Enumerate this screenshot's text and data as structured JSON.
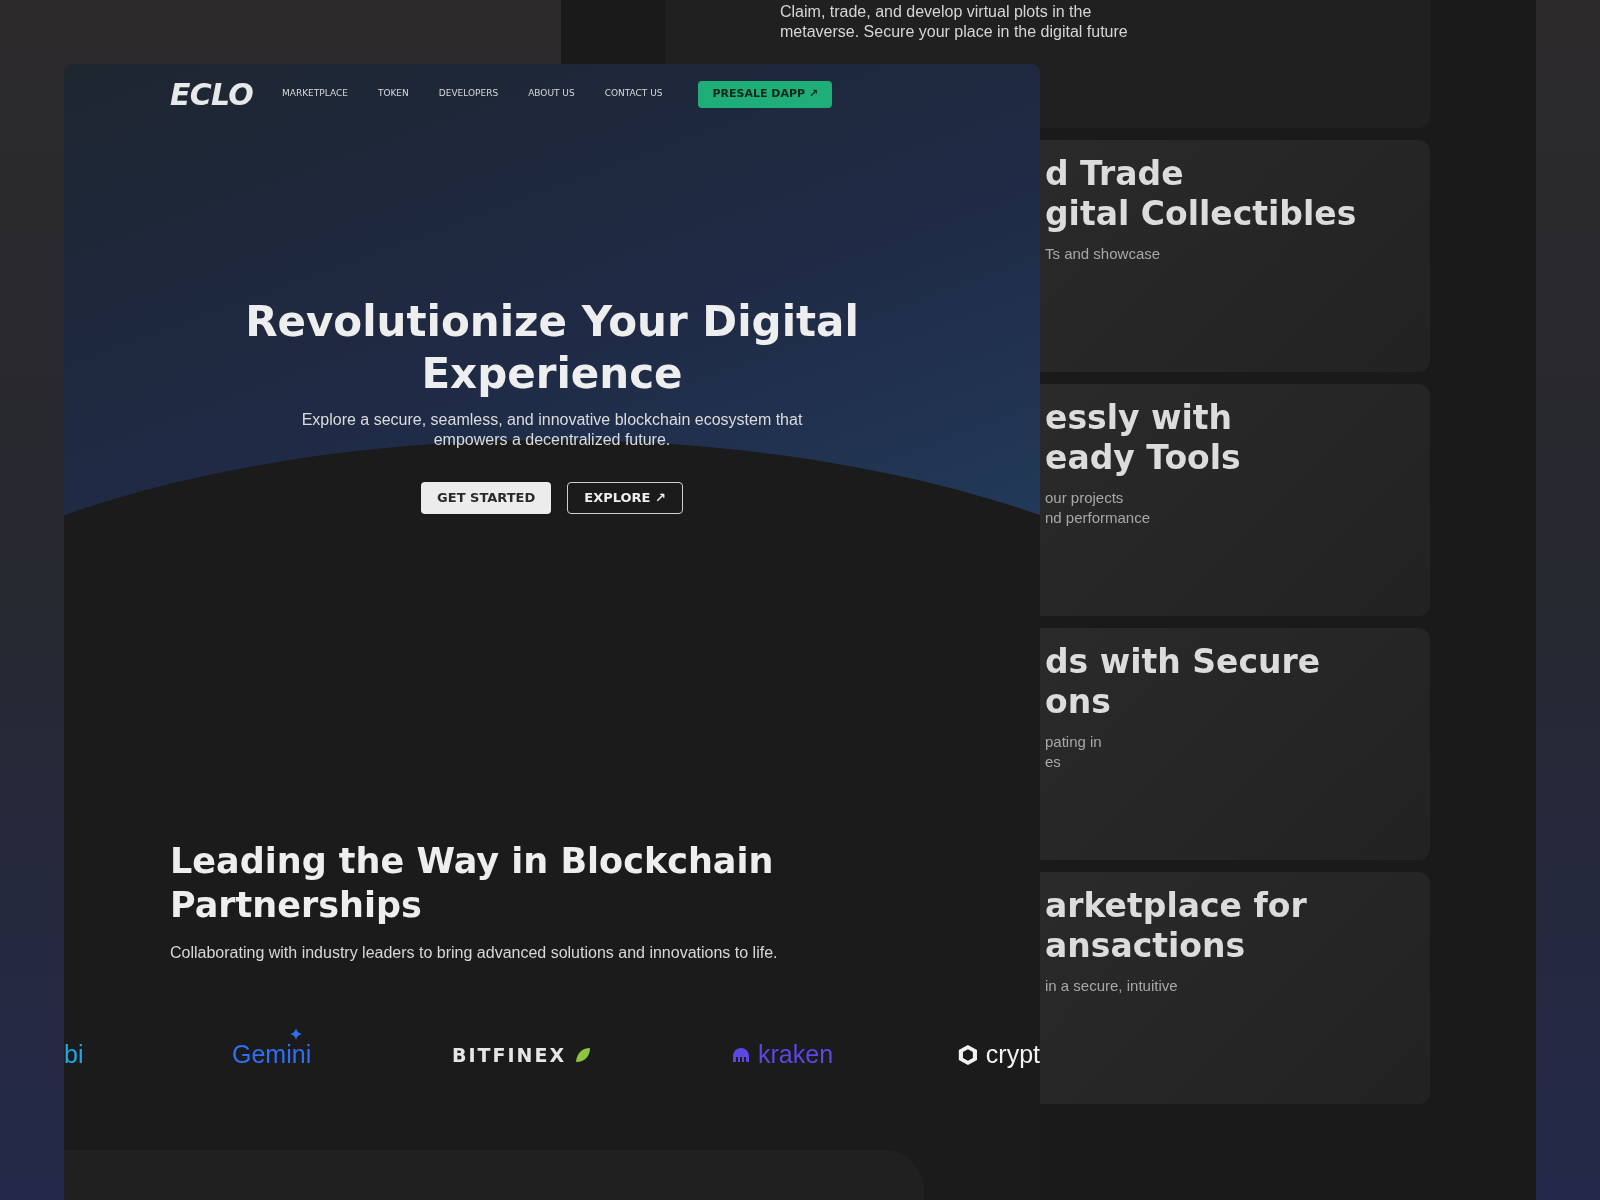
{
  "back_page": {
    "top_card": {
      "description": "Claim, trade, and develop virtual plots in the metaverse. Secure your place in the digital future"
    },
    "cards": [
      {
        "title": [
          "d Trade",
          "gital Collectibles"
        ],
        "description": [
          "Ts and showcase"
        ]
      },
      {
        "title": [
          "essly with",
          "eady Tools"
        ],
        "description": [
          "our projects",
          "nd performance"
        ]
      },
      {
        "title": [
          "ds with Secure",
          "ons"
        ],
        "description": [
          "pating in",
          "es"
        ]
      },
      {
        "title": [
          "arketplace for",
          "ansactions"
        ],
        "description": [
          "in a secure, intuitive"
        ]
      }
    ]
  },
  "front_page": {
    "logo": "ECLO",
    "nav": [
      {
        "label": "MARKETPLACE"
      },
      {
        "label": "TOKEN"
      },
      {
        "label": "DEVELOPERS"
      },
      {
        "label": "ABOUT US"
      },
      {
        "label": "CONTACT US"
      }
    ],
    "cta": "PRESALE DAPP ↗",
    "hero": {
      "title": "Revolutionize Your Digital Experience",
      "subtitle": "Explore a secure, seamless, and innovative blockchain ecosystem that empowers a decentralized future.",
      "primary_button": "GET STARTED",
      "secondary_button": "EXPLORE ↗"
    },
    "partners": {
      "title": "Leading the Way in Blockchain Partnerships",
      "subtitle": "Collaborating with industry leaders to bring advanced solutions and innovations to life.",
      "logos": [
        {
          "kind": "plain",
          "name": "bi",
          "color": "#1ea7e4"
        },
        {
          "kind": "sparkle",
          "name": "Gemini",
          "color": "#2f6ff5"
        },
        {
          "kind": "leaf",
          "name": "BITFINEX",
          "color": "#e6e6e6"
        },
        {
          "kind": "kraken",
          "name": "kraken",
          "color": "#5a48e2"
        },
        {
          "kind": "hex",
          "name": "crypt",
          "color": "#f2f2f2"
        }
      ]
    }
  }
}
